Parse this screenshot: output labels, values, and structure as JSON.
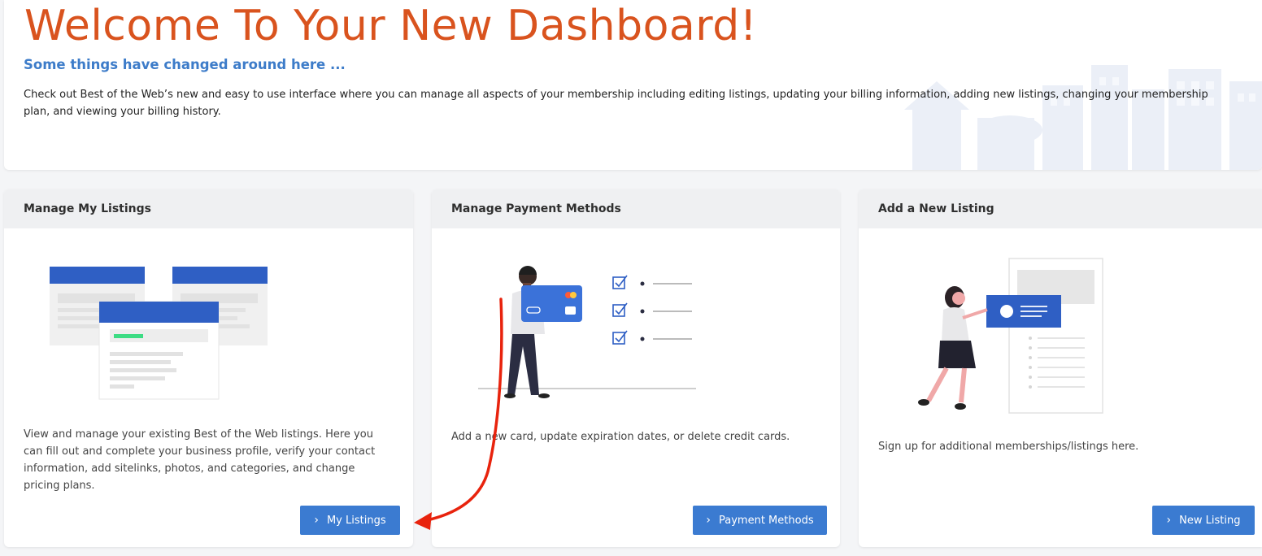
{
  "hero": {
    "title": "Welcome To Your New Dashboard!",
    "subtitle": "Some things have changed around here ...",
    "description": "Check out Best of the Web’s new and easy to use interface where you can manage all aspects of your membership including editing listings, updating your billing information, adding new listings, changing your membership plan, and viewing your billing history."
  },
  "cards": [
    {
      "title": "Manage My Listings",
      "description": "View and manage your existing Best of the Web listings. Here you can fill out and complete your business profile, verify your contact information, add sitelinks, photos, and categories, and change pricing plans.",
      "button_label": "My Listings",
      "button_icon": "chevron-right-icon"
    },
    {
      "title": "Manage Payment Methods",
      "description": "Add a new card, update expiration dates, or delete credit cards.",
      "button_label": "Payment Methods",
      "button_icon": "chevron-right-icon"
    },
    {
      "title": "Add a New Listing",
      "description": "Sign up for additional memberships/listings here.",
      "button_label": "New Listing",
      "button_icon": "chevron-right-icon"
    }
  ],
  "colors": {
    "title_orange": "#d9531e",
    "subtitle_blue": "#3d7cc9",
    "button_blue": "#3b7bd1",
    "annotation_red": "#e8230d"
  }
}
